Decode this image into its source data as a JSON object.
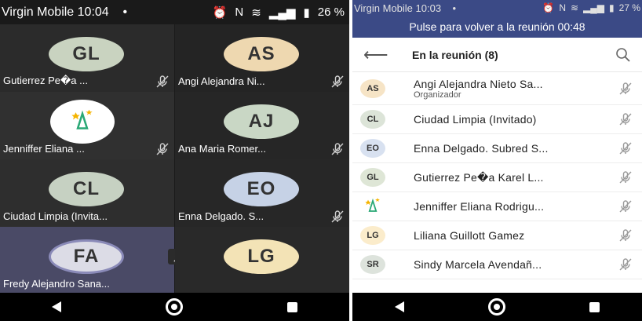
{
  "left_screen": {
    "status": {
      "carrier": "Virgin Mobile 10:04",
      "dot": "•",
      "battery": "26 %"
    },
    "tiles": [
      {
        "initials": "GL",
        "name": "Gutierrez Pe�a ...",
        "color": "#c9d3c0",
        "bg": "#2b2b2b",
        "muted": true
      },
      {
        "initials": "AS",
        "name": "Angi Alejandra Ni...",
        "color": "#eed8b0",
        "bg": "#242424",
        "muted": true
      },
      {
        "initials": "",
        "name": "Jenniffer Eliana ...",
        "color": "#ffffff",
        "bg": "#303030",
        "muted": true,
        "logo": true
      },
      {
        "initials": "AJ",
        "name": "Ana Maria Romer...",
        "color": "#c9d7c5",
        "bg": "#262626",
        "muted": true
      },
      {
        "initials": "CL",
        "name": "Ciudad Limpia (Invita...",
        "color": "#c6d1c2",
        "bg": "#2e2e2e",
        "muted": false
      },
      {
        "initials": "EO",
        "name": "Enna Delgado. S...",
        "color": "#c6d2e6",
        "bg": "#272727",
        "muted": true
      },
      {
        "initials": "FA",
        "name": "Fredy Alejandro Sana...",
        "color": "#dcdce6",
        "bg": "#4a4a66",
        "muted": false,
        "active": true
      },
      {
        "initials": "LG",
        "name": "",
        "color": "#f3e3b6",
        "bg": "#292929",
        "muted": false
      }
    ]
  },
  "right_screen": {
    "status": {
      "carrier": "Virgin Mobile 10:03",
      "dot": "•",
      "battery": "27 %"
    },
    "return_banner": "Pulse para volver a la reunión 00:48",
    "header": {
      "title": "En la reunión (8)"
    },
    "participants": [
      {
        "initials": "AS",
        "name": "Angi Alejandra Nieto Sa...",
        "role": "Organizador",
        "color": "#f6e4c6"
      },
      {
        "initials": "CL",
        "name": "Ciudad Limpia (Invitado)",
        "role": "",
        "color": "#dce4d8"
      },
      {
        "initials": "EO",
        "name": "Enna Delgado. Subred S...",
        "role": "",
        "color": "#d8e1f0"
      },
      {
        "initials": "GL",
        "name": "Gutierrez Pe�a Karel L...",
        "role": "",
        "color": "#dee6d6"
      },
      {
        "initials": "",
        "name": "Jenniffer Eliana Rodrigu...",
        "role": "",
        "color": "#ffffff",
        "logo": true
      },
      {
        "initials": "LG",
        "name": "Liliana Guillott Gamez",
        "role": "",
        "color": "#fbeccb"
      },
      {
        "initials": "SR",
        "name": "Sindy Marcela Avendañ...",
        "role": "",
        "color": "#dde3dc"
      }
    ]
  }
}
